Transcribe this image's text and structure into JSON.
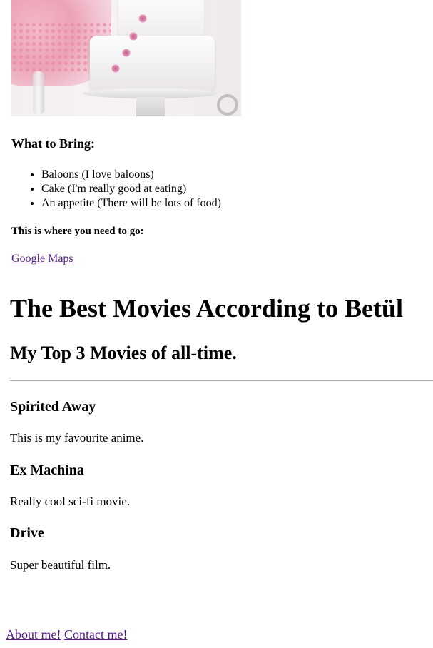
{
  "event": {
    "what_to_bring_heading": "What to Bring:",
    "bring_items": [
      "Baloons (I love baloons)",
      "Cake (I'm really good at eating)",
      "An appetite (There will be lots of food)"
    ],
    "where_heading": "This is where you need to go:",
    "maps_link": "Google Maps"
  },
  "movies": {
    "title": "The Best Movies According to Betül",
    "subtitle": "My Top 3 Movies of all-time.",
    "items": [
      {
        "title": "Spirited Away",
        "description": "This is my favourite anime."
      },
      {
        "title": "Ex Machina",
        "description": "Really cool sci-fi movie."
      },
      {
        "title": "Drive",
        "description": "Super beautiful film."
      }
    ]
  },
  "footer": {
    "about_link": "About me!",
    "contact_link": "Contact me!"
  }
}
